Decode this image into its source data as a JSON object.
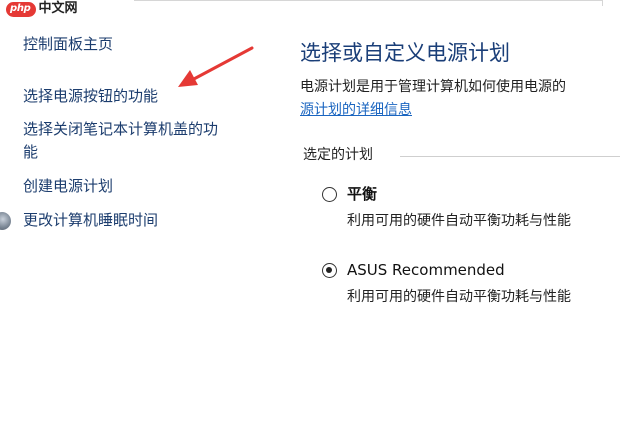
{
  "watermark": {
    "badge": "php",
    "text": "中文网"
  },
  "sidebar": {
    "items": [
      {
        "label": "控制面板主页"
      },
      {
        "label": "选择电源按钮的功能"
      },
      {
        "label_line1": "选择关闭笔记本计算机盖的功",
        "label_line2": "能"
      },
      {
        "label": "创建电源计划"
      },
      {
        "label": "更改计算机睡眠时间",
        "icon": "shield-icon"
      }
    ]
  },
  "main": {
    "title": "选择或自定义电源计划",
    "description": "电源计划是用于管理计算机如何使用电源的",
    "description_link": "源计划的详细信息",
    "group_label": "选定的计划",
    "plans": [
      {
        "name": "平衡",
        "description": "利用可用的硬件自动平衡功耗与性能",
        "selected": false
      },
      {
        "name": "ASUS Recommended",
        "description": "利用可用的硬件自动平衡功耗与性能",
        "selected": true
      }
    ]
  },
  "colors": {
    "link": "#1c3d6e",
    "title": "#1a3e78",
    "annotation_arrow": "#e53935"
  }
}
